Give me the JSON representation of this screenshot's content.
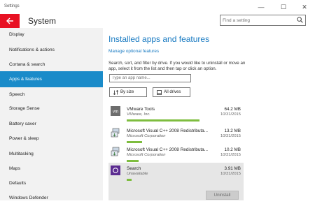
{
  "window": {
    "title": "Settings",
    "minimize": "—",
    "maximize": "☐",
    "close": "✕"
  },
  "header": {
    "back_glyph": "🡐",
    "title": "System",
    "search_placeholder": "Find a setting"
  },
  "sidebar": {
    "items": [
      {
        "label": "Display",
        "active": false
      },
      {
        "label": "Notifications & actions",
        "active": false
      },
      {
        "label": "Cortana & search",
        "active": false
      },
      {
        "label": "Apps & features",
        "active": true
      },
      {
        "label": "Speech",
        "active": false
      },
      {
        "label": "Storage Sense",
        "active": false
      },
      {
        "label": "Battery saver",
        "active": false
      },
      {
        "label": "Power & sleep",
        "active": false
      },
      {
        "label": "Multitasking",
        "active": false
      },
      {
        "label": "Maps",
        "active": false
      },
      {
        "label": "Defaults",
        "active": false
      },
      {
        "label": "Windows Defender",
        "active": false
      }
    ]
  },
  "main": {
    "title": "Installed apps and features",
    "manage_link": "Manage optional features",
    "description": "Search, sort, and filter by drive. If you would like to uninstall or move an app, select it from the list and then tap or click an option.",
    "search_placeholder": "Type an app name...",
    "sort_label": "By size",
    "filter_label": "All drives",
    "uninstall_label": "Uninstall",
    "apps": [
      {
        "name": "VMware Tools",
        "publisher": "VMware, Inc.",
        "size": "64.2 MB",
        "date": "10/31/2015",
        "usage": 0.62,
        "icon": "vmware-icon"
      },
      {
        "name": "Microsoft Visual C++ 2008 Redistributa...",
        "publisher": "Microsoft Corporation",
        "size": "13.2 MB",
        "date": "10/31/2015",
        "usage": 0.13,
        "icon": "installer-icon"
      },
      {
        "name": "Microsoft Visual C++ 2008 Redistributa...",
        "publisher": "Microsoft Corporation",
        "size": "10.2 MB",
        "date": "10/31/2015",
        "usage": 0.1,
        "icon": "installer-icon"
      },
      {
        "name": "Search",
        "publisher": "Unavailable",
        "size": "3.91 MB",
        "date": "10/31/2015",
        "usage": 0.04,
        "icon": "search-app-icon",
        "selected": true
      }
    ]
  },
  "colors": {
    "accent": "#1a8bc9",
    "back_button": "#e81123",
    "usage_bar": "#7ebd3f",
    "search_app_icon": "#5c2d91"
  }
}
